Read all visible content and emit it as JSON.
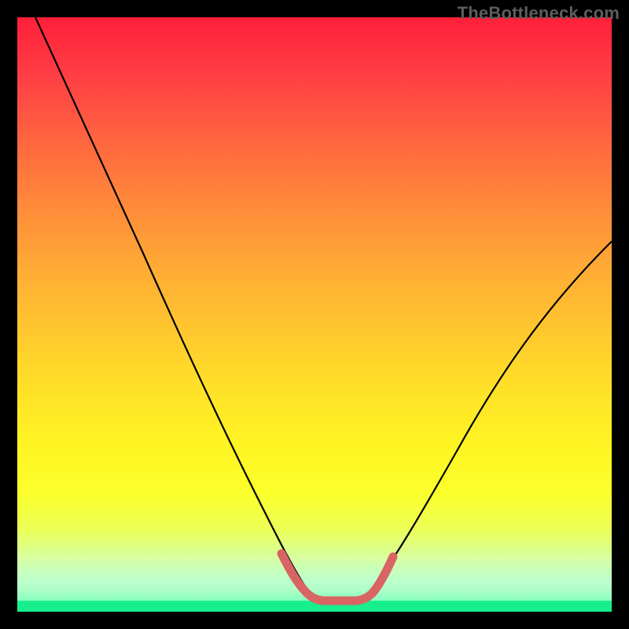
{
  "watermark": {
    "text": "TheBottleneck.com"
  },
  "chart_data": {
    "type": "line",
    "title": "",
    "xlabel": "",
    "ylabel": "",
    "xlim": [
      0,
      100
    ],
    "ylim": [
      0,
      100
    ],
    "grid": false,
    "series": [
      {
        "name": "bottleneck-curve",
        "color": "#000000",
        "x": [
          3,
          6,
          10,
          14,
          18,
          22,
          26,
          30,
          34,
          38,
          41,
          44,
          47,
          50,
          53,
          56,
          60,
          65,
          70,
          76,
          82,
          88,
          94,
          100
        ],
        "y": [
          100,
          94,
          86,
          78,
          71,
          63,
          55,
          48,
          40,
          32,
          25,
          18,
          12,
          6,
          3,
          3,
          6,
          12,
          20,
          29,
          38,
          47,
          55,
          62
        ]
      },
      {
        "name": "optimal-range-marker",
        "color": "#d96464",
        "x": [
          44,
          46,
          48,
          50,
          52,
          54,
          56,
          58
        ],
        "y": [
          10,
          5,
          3,
          3,
          3,
          3,
          5,
          10
        ]
      }
    ],
    "background_gradient": {
      "top": "#ff1f3a",
      "middle": "#fff423",
      "bottom": "#18ef8c"
    }
  }
}
